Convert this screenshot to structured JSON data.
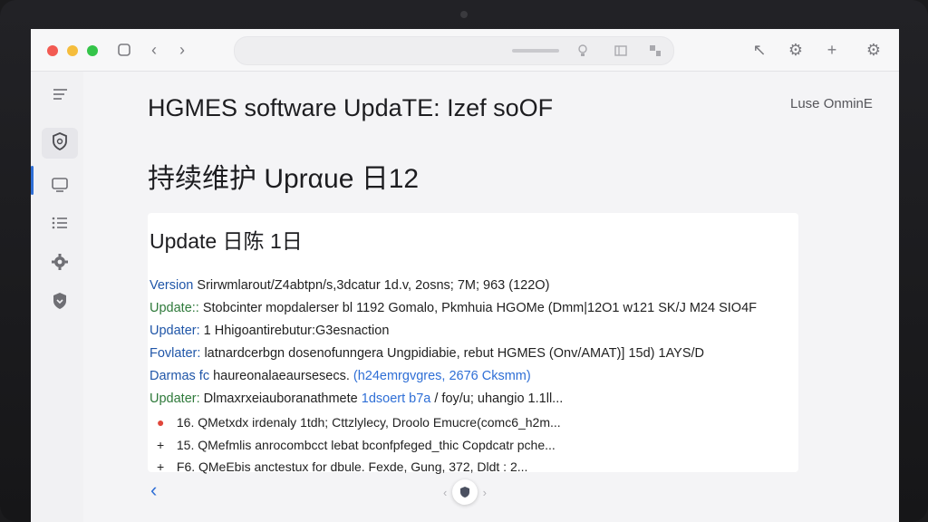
{
  "toolbar": {
    "square_icon": "□",
    "back_icon": "‹",
    "forward_icon": "›",
    "right_icons": [
      "↖",
      "⚙",
      "+",
      "⚙"
    ]
  },
  "header": {
    "title": "HGMES software UpdaTE: Izef soOF",
    "user": "Luse OnminE",
    "subtitle": "持续维护 Uprαue 日12"
  },
  "card": {
    "title": "Update 日陈 1日",
    "rows": [
      {
        "label": "Version",
        "text": "Srirwmlarout/Z4abtpn/s,3dcatur 1d.v, 2osns; 7M; 963 (122O)",
        "label_color": "blue"
      },
      {
        "label": "Update::",
        "text": "Stobcinter mopdalerser bl 1192 Gomalo, Pkmhuia HGOMe (Dmm|12O1 w121 SK/J M24 SIO4F",
        "label_color": "green"
      },
      {
        "label": "Updater:",
        "text": "1 Hhigoantirebutur:G3esnaction",
        "label_color": "blue"
      },
      {
        "label": "Fovlater:",
        "text": "latnardcerbgn dosenofunngera Ungpidiabie, rebut HGMES (Onv/AMAT)] 15d) 1AYS/D",
        "label_color": "blue"
      },
      {
        "label": "Darmas fc",
        "text": "haureonalaeaursesecs.",
        "link": "(h24emrgvgres, 2676 Cksmm)",
        "label_color": "blue"
      },
      {
        "label": "Updater:",
        "text": "Dlmaxrxeiauboranathmete",
        "link": "1dsoert b7a",
        "tail": "/ foy/u; uhangio 1.1ll...",
        "label_color": "green"
      }
    ],
    "subitems": [
      {
        "marker": "●",
        "text": "16. QMetxdx irdenaly 1tdh; Cttzlylecy, Droolo Emucre(comc6_h2m..."
      },
      {
        "marker": "+",
        "text": "15. QMefmlis anrocombcct lebat bconfpfeged_thic Copdcatr pche..."
      },
      {
        "marker": "+",
        "text": "F6. QMeEbis anctestux for dbule. Fexde, Gung, 372, Dldt : 2..."
      }
    ]
  },
  "footer": {
    "back_icon": "‹",
    "prev_icon": "‹",
    "next_icon": "›"
  }
}
